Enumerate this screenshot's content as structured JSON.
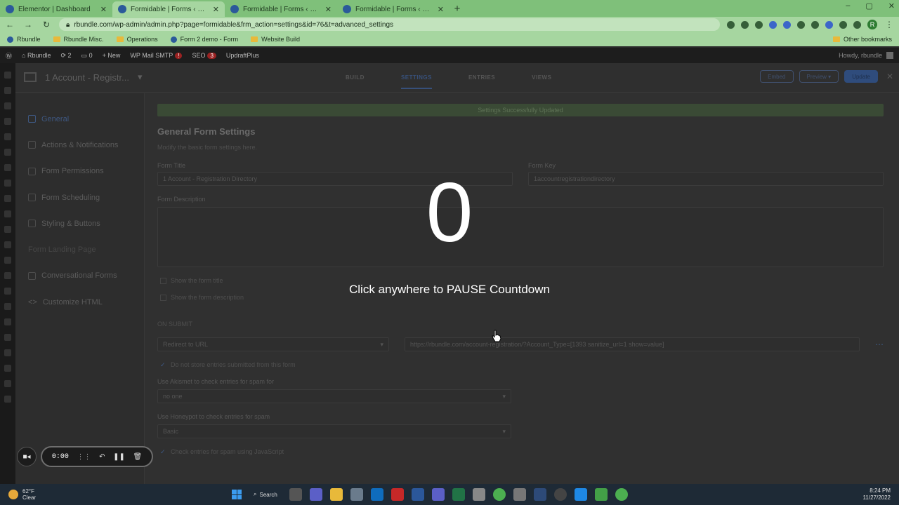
{
  "browser": {
    "tabs": [
      {
        "title": "Elementor | Dashboard",
        "active": false
      },
      {
        "title": "Formidable | Forms ‹ Rbundle —",
        "active": true
      },
      {
        "title": "Formidable | Forms ‹ Rbundle —",
        "active": false
      },
      {
        "title": "Formidable | Forms ‹ Rbundle —",
        "active": false
      }
    ],
    "new_tab": "+",
    "url": "rbundle.com/wp-admin/admin.php?page=formidable&frm_action=settings&id=76&t=advanced_settings",
    "bookmarks": [
      "Rbundle",
      "Rbundle Misc.",
      "Operations",
      "Form 2 demo - Form",
      "Website Build"
    ],
    "other_bookmarks": "Other bookmarks",
    "profile_initial": "R"
  },
  "wp_admin_bar": {
    "site": "Rbundle",
    "updates": "2",
    "comments": "0",
    "new": "New",
    "smtp": "WP Mail SMTP",
    "smtp_badge": "!",
    "seo": "SEO",
    "seo_badge": "3",
    "updraft": "UpdraftPlus",
    "howdy": "Howdy, rbundle"
  },
  "form_header": {
    "form_name": "1 Account - Registr...",
    "tabs": [
      "BUILD",
      "SETTINGS",
      "ENTRIES",
      "VIEWS"
    ],
    "active_tab": "SETTINGS",
    "embed": "Embed",
    "preview": "Preview ▾",
    "update": "Update",
    "close": "✕"
  },
  "settings_menu": [
    {
      "label": "General",
      "state": "active"
    },
    {
      "label": "Actions & Notifications",
      "state": "normal"
    },
    {
      "label": "Form Permissions",
      "state": "normal"
    },
    {
      "label": "Form Scheduling",
      "state": "normal"
    },
    {
      "label": "Styling & Buttons",
      "state": "normal"
    },
    {
      "label": "Form Landing Page",
      "state": "disabled"
    },
    {
      "label": "Conversational Forms",
      "state": "normal"
    },
    {
      "label": "Customize HTML",
      "state": "normal"
    }
  ],
  "general": {
    "notice": "Settings Successfully Updated",
    "heading": "General Form Settings",
    "subheading": "Modify the basic form settings here.",
    "form_title_label": "Form Title",
    "form_title_value": "1 Account - Registration Directory",
    "form_key_label": "Form Key",
    "form_key_value": "1accountregistrationdirectory",
    "form_description_label": "Form Description",
    "show_title": "Show the form title",
    "show_description": "Show the form description",
    "on_submit": "ON SUBMIT",
    "on_submit_action": "Redirect to URL",
    "redirect_url": "https://rbundle.com/account-registration/?Account_Type=[1393 sanitize_url=1 show=value]",
    "no_store": "Do not store entries submitted from this form",
    "akismet_label": "Use Akismet to check entries for spam for",
    "akismet_value": "no one",
    "honeypot_label": "Use Honeypot to check entries for spam",
    "honeypot_value": "Basic",
    "js_check": "Check entries for spam using JavaScript"
  },
  "overlay": {
    "countdown": "0",
    "message": "Click anywhere to PAUSE Countdown"
  },
  "recorder": {
    "time": "0:00"
  },
  "taskbar": {
    "temp": "62°F",
    "condition": "Clear",
    "search": "Search",
    "time": "8:24 PM",
    "date": "11/27/2022"
  }
}
